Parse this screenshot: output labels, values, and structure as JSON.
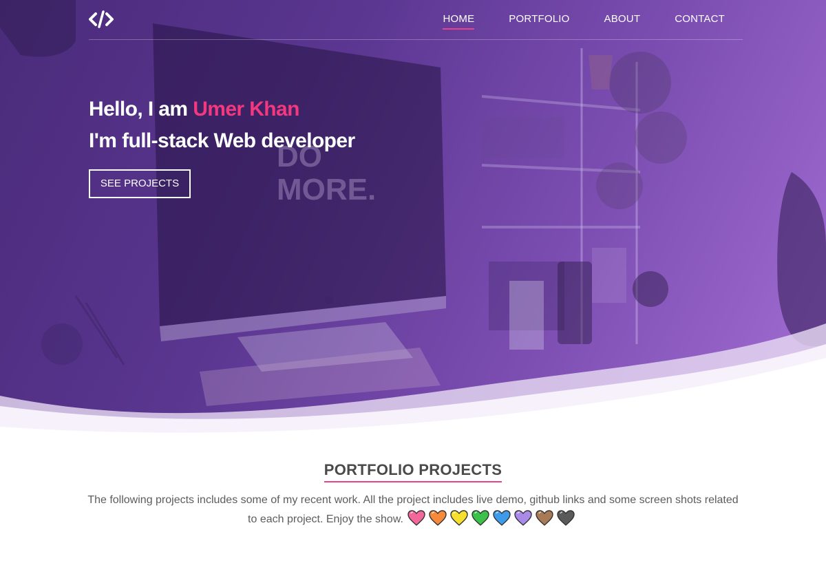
{
  "nav": {
    "logo_icon": "code-icon",
    "links": [
      {
        "label": "HOME",
        "active": true
      },
      {
        "label": "PORTFOLIO",
        "active": false
      },
      {
        "label": "ABOUT",
        "active": false
      },
      {
        "label": "CONTACT",
        "active": false
      }
    ]
  },
  "hero": {
    "greeting": "Hello, I am ",
    "name": "Umer Khan",
    "tagline": "I'm full-stack Web developer",
    "cta_label": "SEE PROJECTS",
    "poster_lines": [
      "DO",
      "MORE."
    ]
  },
  "portfolio": {
    "title": "PORTFOLIO PROJECTS",
    "description": "The following projects includes some of my recent work. All the project includes live demo, github links and some screen shots related to each project. Enjoy the show.",
    "hearts": [
      {
        "icon": "pink-heart-icon",
        "color": "#f4679a"
      },
      {
        "icon": "orange-heart-icon",
        "color": "#f7893a"
      },
      {
        "icon": "yellow-heart-icon",
        "color": "#f6df2e"
      },
      {
        "icon": "green-heart-icon",
        "color": "#3cc24a"
      },
      {
        "icon": "blue-heart-icon",
        "color": "#3d9be9"
      },
      {
        "icon": "purple-heart-icon",
        "color": "#a98ae8"
      },
      {
        "icon": "brown-heart-icon",
        "color": "#a87a55"
      },
      {
        "icon": "black-heart-icon",
        "color": "#5a5a5a"
      }
    ]
  },
  "colors": {
    "accent": "#e8428f",
    "name_highlight": "#f2387e",
    "hero_dark": "#4a2b7a",
    "hero_light": "#a46fd4"
  }
}
